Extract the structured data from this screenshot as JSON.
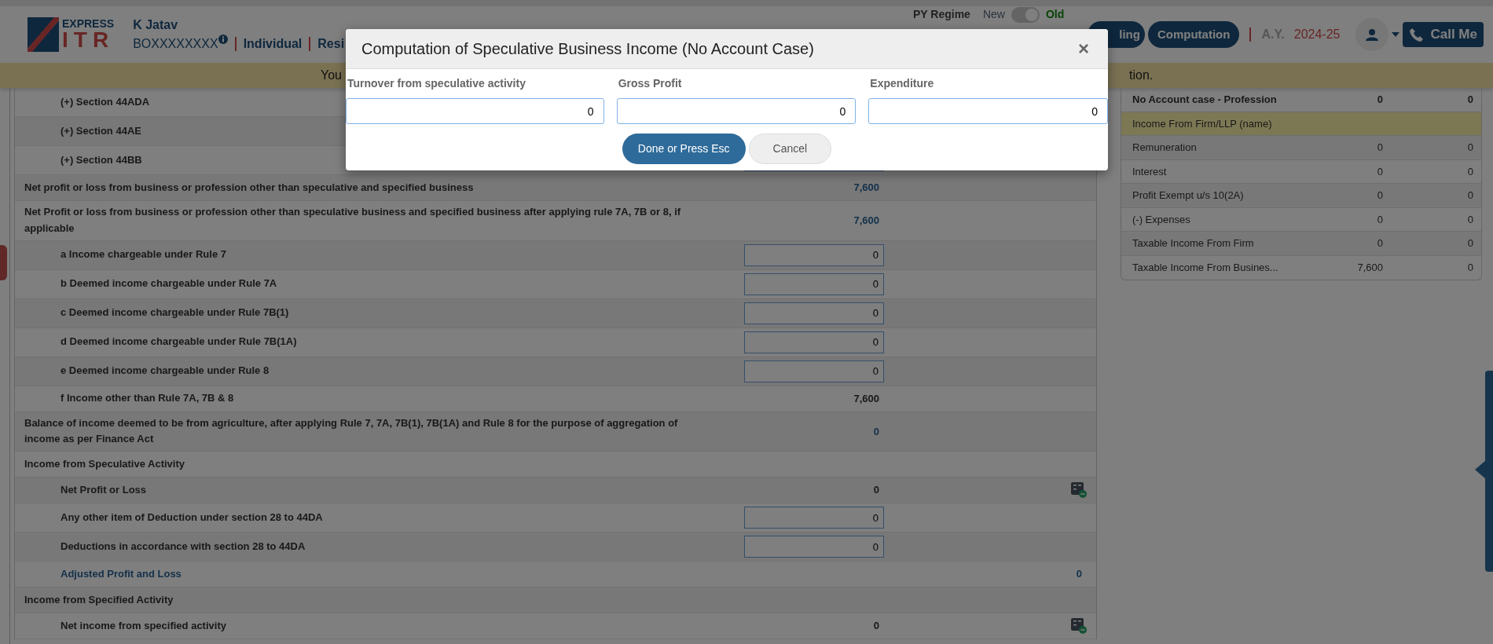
{
  "header": {
    "logo": {
      "top": "EXPRESS",
      "bottom": "ITR"
    },
    "user_name": "K Jatav",
    "pan": "BOXXXXXXXX",
    "category": "Individual",
    "residency": "Resi",
    "regime": {
      "label": "PY Regime",
      "options": [
        {
          "label": "New",
          "selected": false
        },
        {
          "label": "Old",
          "selected": true
        }
      ]
    },
    "nav_buttons": [
      {
        "label": "ling"
      },
      {
        "label": "Computation"
      }
    ],
    "ay_label": "A.Y.",
    "ay": "2024-25",
    "call_button": "Call Me"
  },
  "banner": [
    "You",
    "tion."
  ],
  "left_rows": [
    {
      "children": [
        {
          "label": "(+) Section 44ADA",
          "kind": "input"
        },
        {
          "label": "(+) Section 44AE",
          "kind": "input"
        },
        {
          "label": "(+) Section 44BB",
          "kind": "input"
        }
      ]
    },
    {
      "label": "Net profit or loss from business or profession other than speculative and specified business",
      "kind": "link",
      "value": "7,600"
    },
    {
      "label": "Net Profit or loss from business or profession other than speculative business and specified business after applying rule 7A, 7B or 8, if applicable",
      "kind": "link",
      "value": "7,600",
      "children": [
        {
          "label": "a Income chargeable under Rule 7",
          "kind": "input",
          "value": "0"
        },
        {
          "label": "b Deemed income chargeable under Rule 7A",
          "kind": "input",
          "value": "0"
        },
        {
          "label": "c Deemed income chargeable under Rule 7B(1)",
          "kind": "input",
          "value": "0"
        },
        {
          "label": "d Deemed income chargeable under Rule 7B(1A)",
          "kind": "input",
          "value": "0"
        },
        {
          "label": "e Deemed income chargeable under Rule 8",
          "kind": "input",
          "value": "0"
        },
        {
          "label": "f Income other than Rule 7A, 7B & 8",
          "kind": "total",
          "value": "7,600"
        }
      ]
    },
    {
      "label": "Balance of income deemed to be from agriculture, after applying Rule 7, 7A, 7B(1), 7B(1A) and Rule 8 for the purpose of aggregation of income as per Finance Act",
      "kind": "link",
      "value": "0"
    },
    {
      "label": "Income from Speculative Activity",
      "kind": "heading",
      "children": [
        {
          "label": "Net Profit or Loss",
          "kind": "total",
          "value": "0",
          "calculator": true
        },
        {
          "label": "Any other item of Deduction under section 28 to 44DA",
          "kind": "input",
          "value": "0"
        },
        {
          "label": "Deductions in accordance with section 28 to 44DA",
          "kind": "input",
          "value": "0"
        },
        {
          "label": "Adjusted Profit and Loss",
          "kind": "adjusted",
          "value": "0"
        }
      ]
    },
    {
      "label": "Income from Specified Activity",
      "kind": "heading",
      "children": [
        {
          "label": "Net income from specified activity",
          "kind": "total",
          "value": "0",
          "calculator": true
        }
      ]
    }
  ],
  "right_rows": [
    {
      "kind": "header",
      "label": "No Account case - Profession",
      "col_2": "0",
      "col_3": "0"
    },
    {
      "kind": "section",
      "label": "Income From Firm/LLP (name)"
    },
    {
      "kind": "row",
      "label": "Remuneration",
      "col_2": "0",
      "col_3": "0"
    },
    {
      "kind": "row",
      "label": "Interest",
      "col_2": "0",
      "col_3": "0"
    },
    {
      "kind": "row",
      "label": "Profit Exempt u/s 10(2A)",
      "col_2": "0",
      "col_3": "0"
    },
    {
      "kind": "row",
      "label": "(-) Expenses",
      "col_2": "0",
      "col_3": "0"
    },
    {
      "kind": "row",
      "label": "Taxable Income From Firm",
      "col_2": "0",
      "col_3": "0"
    },
    {
      "kind": "row",
      "label": "Taxable Income From Busines...",
      "col_2": "7,600",
      "col_3": "0"
    }
  ],
  "modal": {
    "title": "Computation of Speculative Business Income (No Account Case)",
    "close": "×",
    "fields": [
      {
        "label": "Turnover from speculative activity",
        "value": "0"
      },
      {
        "label": "Gross Profit",
        "value": "0"
      },
      {
        "label": "Expenditure",
        "value": "0"
      }
    ],
    "buttons": [
      {
        "kind": "primary",
        "label": "Done or Press Esc"
      },
      {
        "kind": "secondary",
        "label": "Cancel"
      }
    ]
  }
}
